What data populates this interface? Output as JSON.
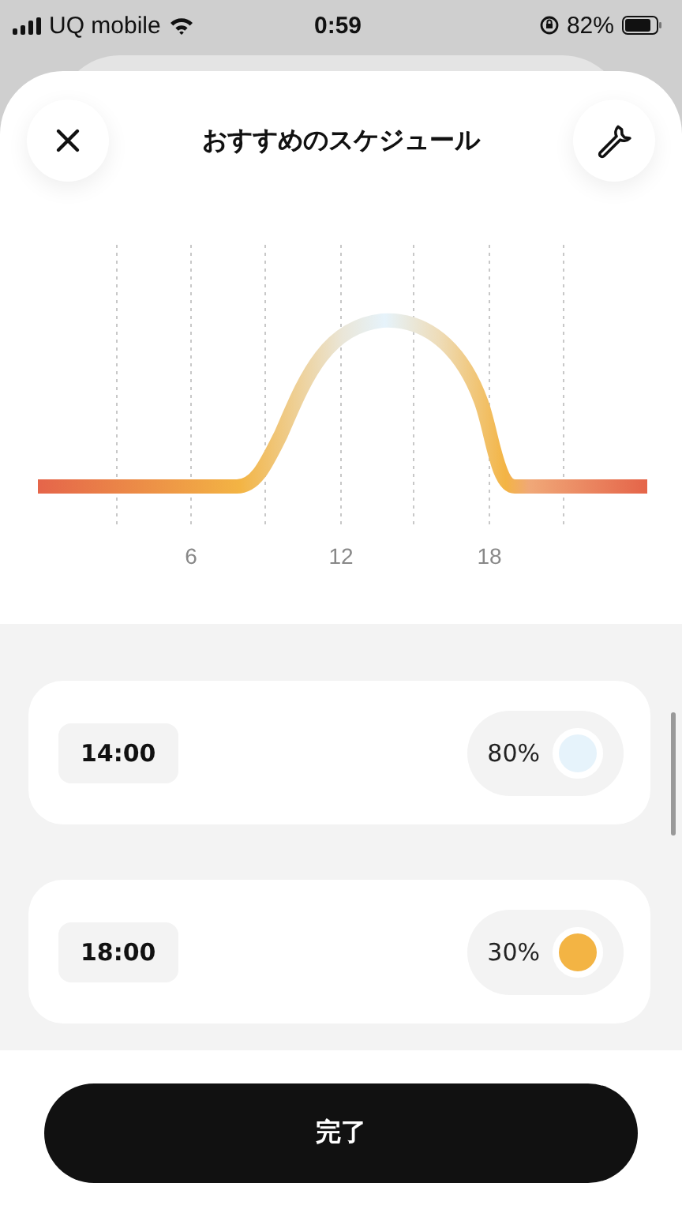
{
  "status_bar": {
    "carrier": "UQ mobile",
    "time": "0:59",
    "battery": "82%"
  },
  "header": {
    "title": "おすすめのスケジュール"
  },
  "chart": {
    "x_labels": [
      "6",
      "12",
      "18"
    ]
  },
  "schedule": [
    {
      "time": "14:00",
      "brightness": "80%",
      "color": "#e6f3fb"
    },
    {
      "time": "18:00",
      "brightness": "30%",
      "color": "#f3b444"
    }
  ],
  "done_button": "完了"
}
